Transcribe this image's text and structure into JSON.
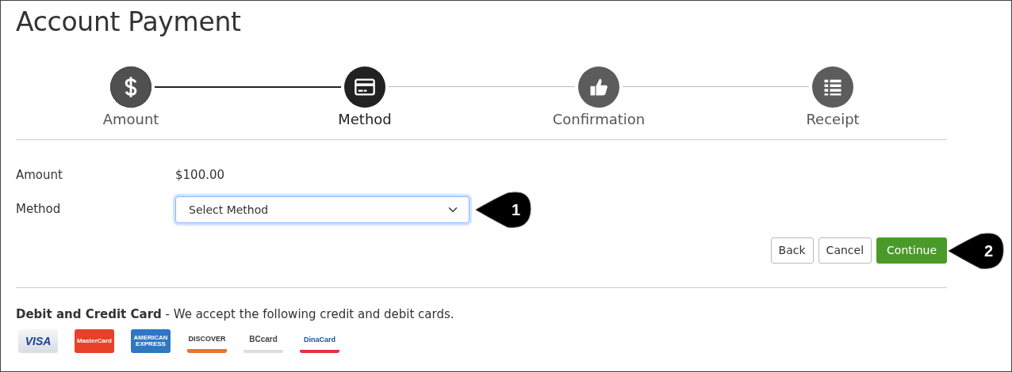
{
  "title": "Account Payment",
  "steps": [
    {
      "label": "Amount",
      "kind": "dollar",
      "completed": true,
      "selected": false
    },
    {
      "label": "Method",
      "kind": "card",
      "completed": false,
      "selected": true
    },
    {
      "label": "Confirmation",
      "kind": "thumbs",
      "completed": false,
      "selected": false
    },
    {
      "label": "Receipt",
      "kind": "list",
      "completed": false,
      "selected": false
    }
  ],
  "form": {
    "amount_label": "Amount",
    "amount_value": "$100.00",
    "method_label": "Method",
    "method_select": {
      "placeholder": "Select Method",
      "focused": true
    }
  },
  "buttons": [
    {
      "label": "Back",
      "kind": "secondary"
    },
    {
      "label": "Cancel",
      "kind": "secondary"
    },
    {
      "label": "Continue",
      "kind": "primary"
    }
  ],
  "callouts": [
    {
      "number": "1"
    },
    {
      "number": "2"
    }
  ],
  "cards_section": {
    "title": "Debit and Credit Card",
    "text": "- We accept the following credit and debit cards.",
    "logos": [
      {
        "kind": "visa",
        "text": "VISA"
      },
      {
        "kind": "mastercard",
        "text": "MasterCard"
      },
      {
        "kind": "amex",
        "text": "AMERICAN EXPRESS"
      },
      {
        "kind": "discover",
        "text": "DISCOVER"
      },
      {
        "kind": "bccard",
        "text": "BCcard"
      },
      {
        "kind": "dinacard",
        "text": "DinaCard"
      }
    ]
  }
}
